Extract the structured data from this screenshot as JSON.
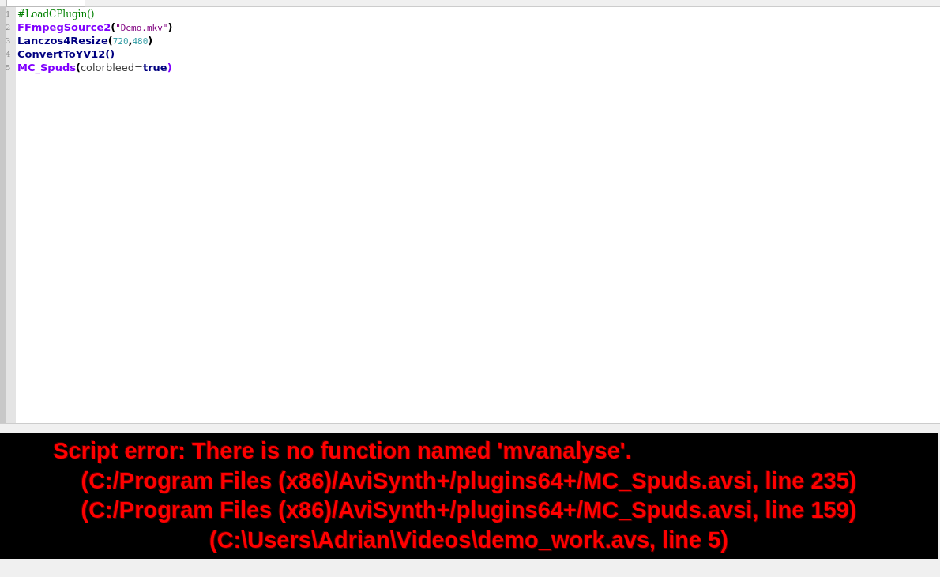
{
  "editor": {
    "lines": [
      {
        "number": "1",
        "tokens": [
          {
            "text": "#LoadCPlugin()",
            "kind": "comment"
          }
        ]
      },
      {
        "number": "2",
        "tokens": [
          {
            "text": "FFmpegSource2",
            "kind": "plugin"
          },
          {
            "text": "(",
            "kind": "paren"
          },
          {
            "text": "\"Demo.mkv\"",
            "kind": "string"
          },
          {
            "text": ")",
            "kind": "paren"
          }
        ]
      },
      {
        "number": "3",
        "tokens": [
          {
            "text": "Lanczos4Resize",
            "kind": "function"
          },
          {
            "text": "(",
            "kind": "paren"
          },
          {
            "text": "720",
            "kind": "number"
          },
          {
            "text": ",",
            "kind": "paren"
          },
          {
            "text": "480",
            "kind": "number"
          },
          {
            "text": ")",
            "kind": "paren"
          }
        ]
      },
      {
        "number": "4",
        "tokens": [
          {
            "text": "ConvertToYV12()",
            "kind": "function"
          }
        ]
      },
      {
        "number": "5",
        "tokens": [
          {
            "text": "MC_Spuds",
            "kind": "plugin"
          },
          {
            "text": "(",
            "kind": "paren"
          },
          {
            "text": "colorbleed",
            "kind": "param"
          },
          {
            "text": "=",
            "kind": "param"
          },
          {
            "text": "true",
            "kind": "keyword"
          },
          {
            "text": ")",
            "kind": "plugin"
          }
        ]
      }
    ]
  },
  "error_panel": {
    "lines": [
      "Script error: There is no function named 'mvanalyse'.",
      "(C:/Program Files (x86)/AviSynth+/plugins64+/MC_Spuds.avsi, line 235)",
      "(C:/Program Files (x86)/AviSynth+/plugins64+/MC_Spuds.avsi, line 159)",
      "(C:\\Users\\Adrian\\Videos\\demo_work.avs, line 5)"
    ]
  }
}
